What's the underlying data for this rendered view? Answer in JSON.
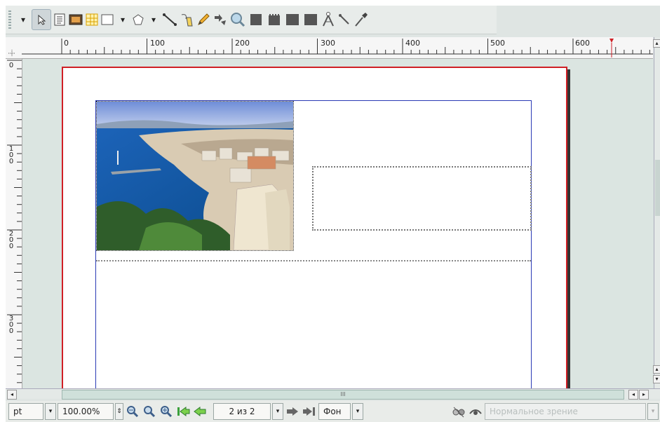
{
  "toolbar": {
    "tools": [
      "select-tool",
      "text-frame-tool",
      "image-frame-tool",
      "table-tool",
      "shape-tool",
      "polygon-tool",
      "line-tool",
      "bezier-tool",
      "freehand-tool",
      "rotate-tool",
      "zoom-tool",
      "edit-contents-tool",
      "link-text-frames-tool",
      "unlink-text-frames-tool",
      "measure-tool",
      "copy-properties-tool",
      "eyedropper-tool"
    ]
  },
  "ruler": {
    "horizontal_labels": [
      "0",
      "100",
      "200",
      "300",
      "400",
      "500",
      "600"
    ],
    "vertical_labels": [
      "0",
      "100",
      "200",
      "300"
    ]
  },
  "statusbar": {
    "unit": "pt",
    "zoom": "100.00%",
    "page": "2 из 2",
    "layer": "Фон",
    "view_mode": "Нормальное зрение"
  },
  "scrollbar": {
    "thumb_label": "III"
  },
  "colors": {
    "page_border": "#d01f25",
    "frame_border": "#2a3ab5",
    "background": "#dbe5e1"
  }
}
